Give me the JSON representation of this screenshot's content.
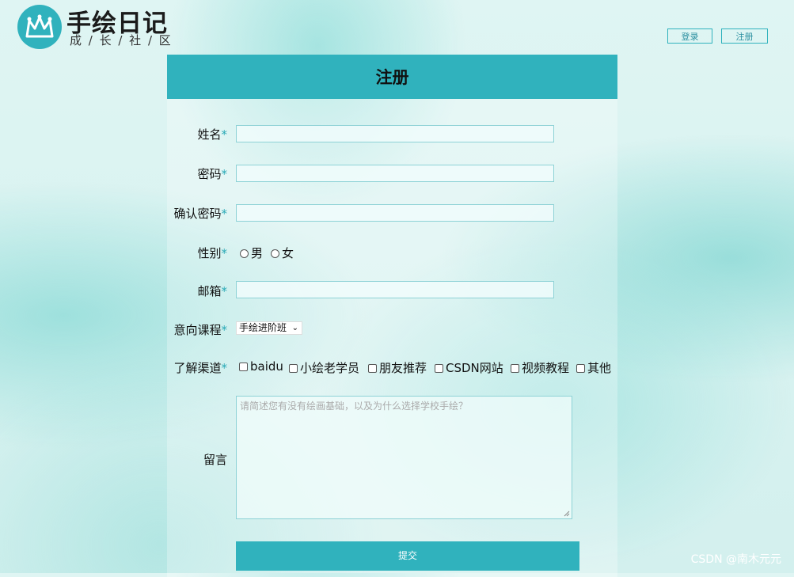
{
  "header": {
    "brand_title": "手绘日记",
    "brand_subtitle": "成 / 长 / 社 / 区",
    "login_label": "登录",
    "register_label": "注册"
  },
  "form": {
    "title": "注册",
    "required_mark": "*",
    "fields": {
      "name_label": "姓名",
      "password_label": "密码",
      "confirm_label": "确认密码",
      "gender_label": "性别",
      "email_label": "邮箱",
      "course_label": "意向课程",
      "channel_label": "了解渠道",
      "message_label": "留言"
    },
    "gender_options": [
      "男",
      "女"
    ],
    "course_selected": "手绘进阶班",
    "channel_options": [
      "baidu",
      "小绘老学员",
      "朋友推荐",
      "CSDN网站",
      "视频教程",
      "其他"
    ],
    "message_placeholder": "请简述您有没有绘画基础，以及为什么选择学校手绘？",
    "submit_label": "提交"
  },
  "watermark": "CSDN @南木元元",
  "colors": {
    "accent": "#30b2bd"
  }
}
